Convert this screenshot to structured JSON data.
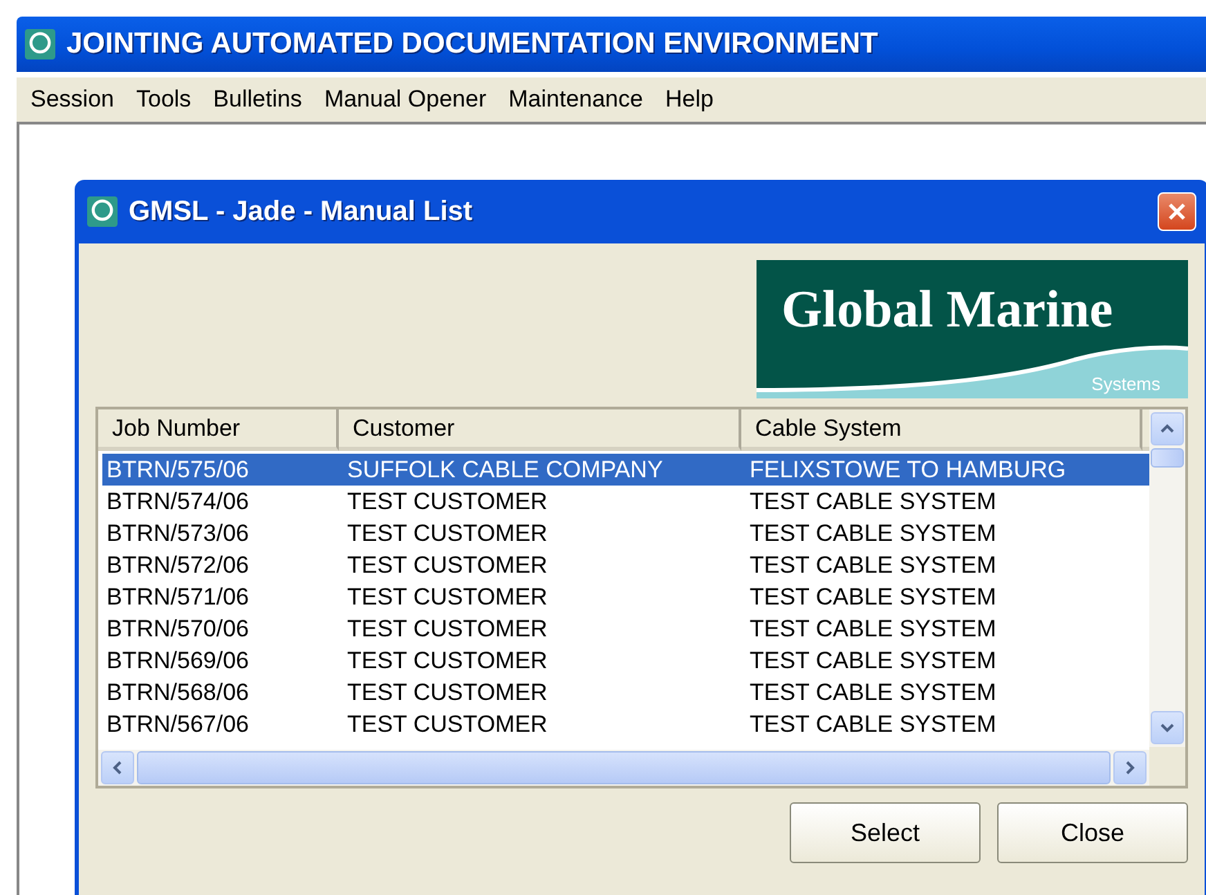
{
  "window": {
    "title": "JOINTING AUTOMATED DOCUMENTATION ENVIRONMENT"
  },
  "menu": [
    "Session",
    "Tools",
    "Bulletins",
    "Manual Opener",
    "Maintenance",
    "Help"
  ],
  "dialog": {
    "title": "GMSL - Jade - Manual List",
    "logo": {
      "name": "Global Marine",
      "tagline": "Systems"
    },
    "table": {
      "columns": [
        "Job Number",
        "Customer",
        "Cable System"
      ],
      "rows": [
        {
          "cells": [
            "BTRN/575/06",
            "SUFFOLK CABLE COMPANY",
            "FELIXSTOWE TO HAMBURG"
          ],
          "selected": true
        },
        {
          "cells": [
            "BTRN/574/06",
            "TEST CUSTOMER",
            "TEST CABLE SYSTEM"
          ],
          "selected": false
        },
        {
          "cells": [
            "BTRN/573/06",
            "TEST CUSTOMER",
            "TEST CABLE SYSTEM"
          ],
          "selected": false
        },
        {
          "cells": [
            "BTRN/572/06",
            "TEST CUSTOMER",
            "TEST CABLE SYSTEM"
          ],
          "selected": false
        },
        {
          "cells": [
            "BTRN/571/06",
            "TEST CUSTOMER",
            "TEST CABLE SYSTEM"
          ],
          "selected": false
        },
        {
          "cells": [
            "BTRN/570/06",
            "TEST CUSTOMER",
            "TEST CABLE SYSTEM"
          ],
          "selected": false
        },
        {
          "cells": [
            "BTRN/569/06",
            "TEST CUSTOMER",
            "TEST CABLE SYSTEM"
          ],
          "selected": false
        },
        {
          "cells": [
            "BTRN/568/06",
            "TEST CUSTOMER",
            "TEST CABLE SYSTEM"
          ],
          "selected": false
        },
        {
          "cells": [
            "BTRN/567/06",
            "TEST CUSTOMER",
            "TEST CABLE SYSTEM"
          ],
          "selected": false
        }
      ]
    },
    "buttons": [
      "Select",
      "Close"
    ]
  }
}
